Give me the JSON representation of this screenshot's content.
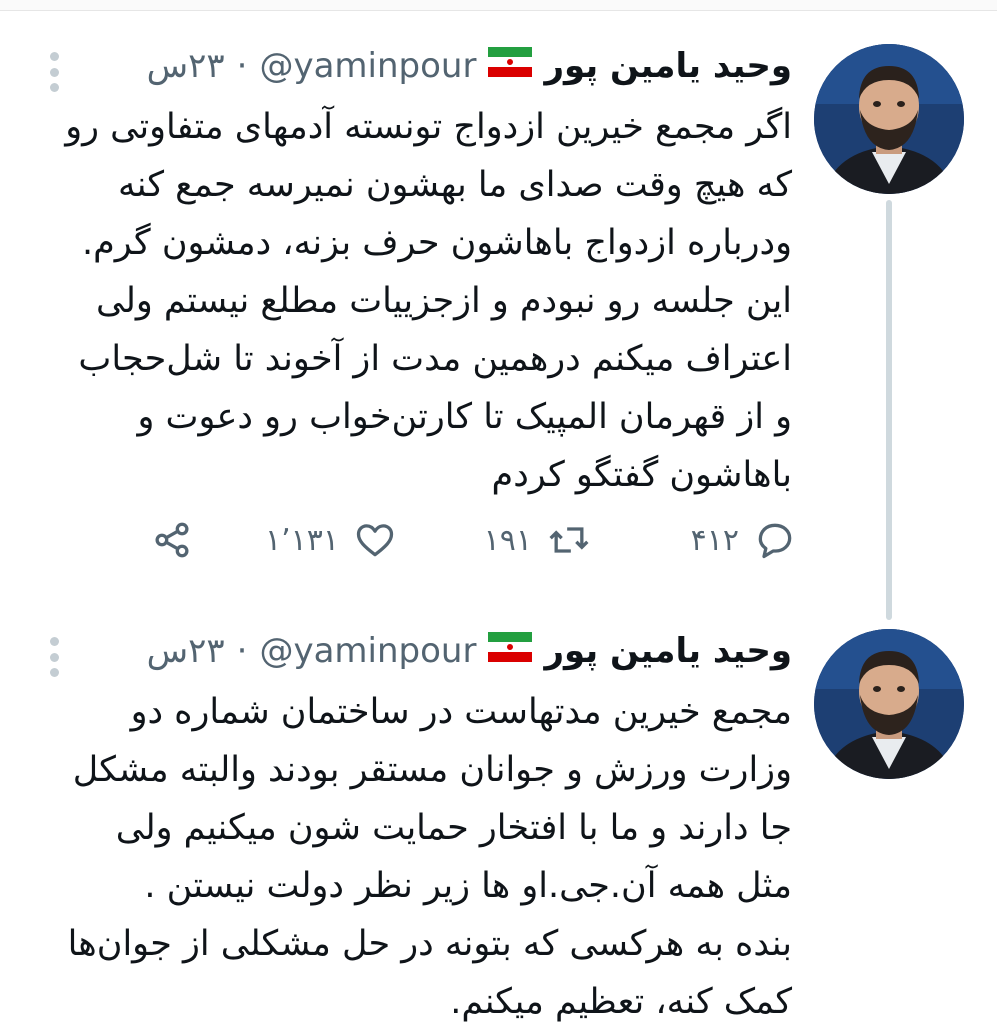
{
  "tweets": [
    {
      "author_name": "وحید یامین پور",
      "handle": "@yaminpour",
      "separator": "·",
      "time": "۲۳س",
      "lines": [
        "اگر مجمع خیرین ازدواج تونسته آدمهای متفاوتی رو",
        "که هیچ وقت صدای ما بهشون نمیرسه جمع کنه",
        "ودرباره ازدواج باهاشون حرف بزنه، دمشون گرم.",
        "این جلسه رو نبودم و ازجزییات مطلع نیستم ولی",
        "اعتراف میکنم درهمین مدت از آخوند تا شل‌حجاب",
        "و از قهرمان المپیک تا کارتن‌خواب رو دعوت و",
        "باهاشون گفتگو کردم"
      ],
      "replies": "۴۱۲",
      "retweets": "۱۹۱",
      "likes": "۱٬۱۳۱"
    },
    {
      "author_name": "وحید یامین پور",
      "handle": "@yaminpour",
      "separator": "·",
      "time": "۲۳س",
      "lines": [
        "مجمع خیرین مدتهاست در ساختمان شماره دو",
        "وزارت ورزش و جوانان مستقر بودند والبته مشکل",
        "جا دارند و ما با افتخار حمایت شون میکنیم ولی",
        "مثل همه آن.جی.او ها زیر نظر دولت نیستن .",
        "بنده به هرکسی که بتونه در حل مشکلی از جوان‌ها",
        "کمک کنه، تعظیم میکنم."
      ]
    }
  ],
  "colors": {
    "text": "#0f1419",
    "secondary": "#536471",
    "thread_line": "#cfd9de",
    "flag_green": "#239f40",
    "flag_red": "#da0000"
  },
  "icons": [
    "more-icon",
    "reply-icon",
    "retweet-icon",
    "like-icon",
    "share-icon",
    "iran-flag-icon"
  ]
}
